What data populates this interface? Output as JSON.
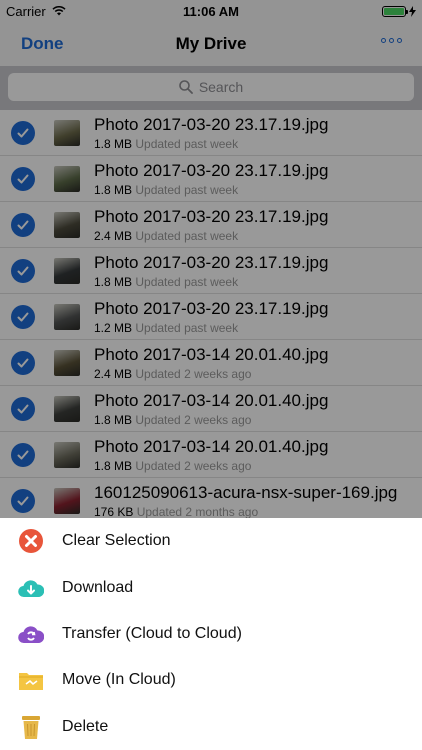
{
  "status_bar": {
    "carrier": "Carrier",
    "time": "11:06 AM"
  },
  "nav": {
    "done_label": "Done",
    "title": "My Drive"
  },
  "search": {
    "placeholder": "Search"
  },
  "files": [
    {
      "name": "Photo 2017-03-20 23.17.19.jpg",
      "size": "1.8 MB",
      "updated": "Updated past week",
      "thumb_color": "#6c6a4a"
    },
    {
      "name": "Photo 2017-03-20 23.17.19.jpg",
      "size": "1.8 MB",
      "updated": "Updated past week",
      "thumb_color": "#5d6b49"
    },
    {
      "name": "Photo 2017-03-20 23.17.19.jpg",
      "size": "2.4 MB",
      "updated": "Updated past week",
      "thumb_color": "#4d4b3d"
    },
    {
      "name": "Photo 2017-03-20 23.17.19.jpg",
      "size": "1.8 MB",
      "updated": "Updated past week",
      "thumb_color": "#34383a"
    },
    {
      "name": "Photo 2017-03-20 23.17.19.jpg",
      "size": "1.2 MB",
      "updated": "Updated past week",
      "thumb_color": "#525454"
    },
    {
      "name": "Photo 2017-03-14 20.01.40.jpg",
      "size": "2.4 MB",
      "updated": "Updated 2 weeks ago",
      "thumb_color": "#5a5238"
    },
    {
      "name": "Photo 2017-03-14 20.01.40.jpg",
      "size": "1.8 MB",
      "updated": "Updated 2 weeks ago",
      "thumb_color": "#3d3f3c"
    },
    {
      "name": "Photo 2017-03-14 20.01.40.jpg",
      "size": "1.8 MB",
      "updated": "Updated 2 weeks ago",
      "thumb_color": "#6b6a5c"
    },
    {
      "name": "160125090613-acura-nsx-super-169.jpg",
      "size": "176 KB",
      "updated": "Updated 2 months ago",
      "thumb_color": "#8a2230"
    }
  ],
  "actions": [
    {
      "label": "Clear Selection",
      "icon": "clear-selection-icon",
      "color": "#e8553a"
    },
    {
      "label": "Download",
      "icon": "download-icon",
      "color": "#2bbfb5"
    },
    {
      "label": "Transfer (Cloud to Cloud)",
      "icon": "transfer-icon",
      "color": "#8a4fc7"
    },
    {
      "label": "Move (In Cloud)",
      "icon": "folder-move-icon",
      "color": "#f4c542"
    },
    {
      "label": "Delete",
      "icon": "trash-icon",
      "color": "#e6b84a"
    }
  ],
  "colors": {
    "accent": "#1e6bd6",
    "battery": "#4cd964"
  }
}
